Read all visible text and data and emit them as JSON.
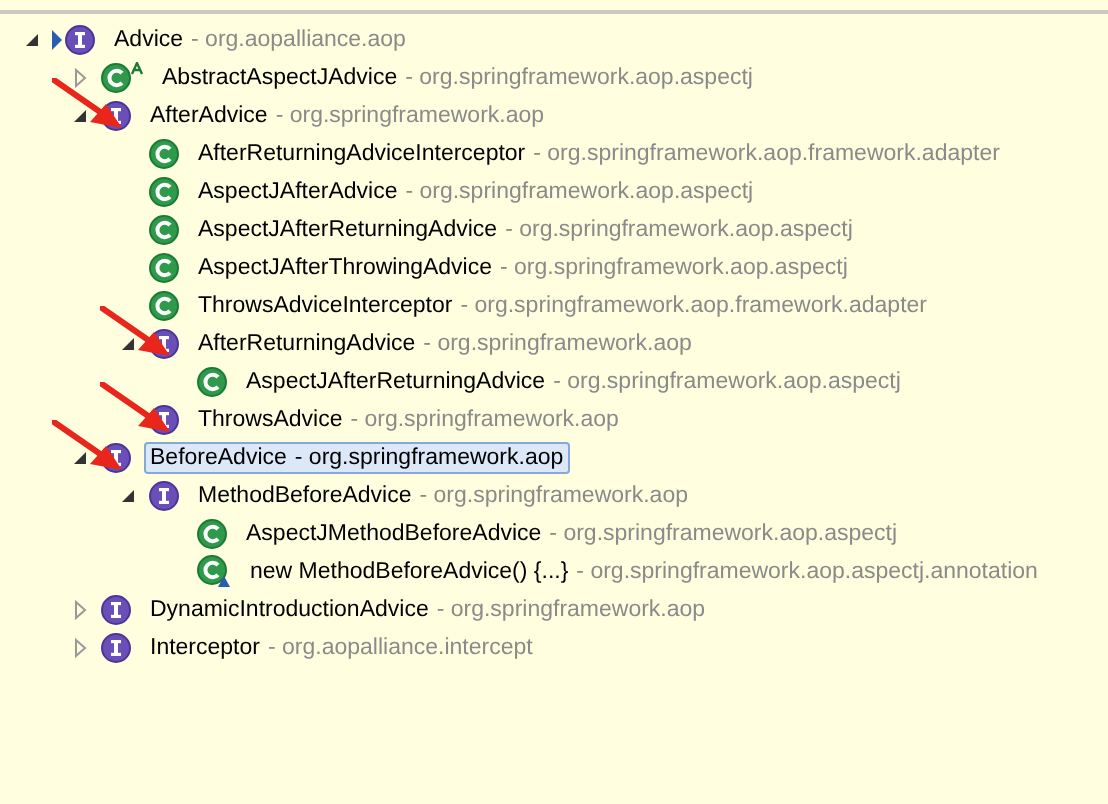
{
  "tree": [
    {
      "name": "Advice",
      "package": "- org.aopalliance.aop",
      "kind": "focus_interface",
      "expanded": true,
      "selected": false,
      "marked": false,
      "children": [
        {
          "name": "AbstractAspectJAdvice",
          "package": "- org.springframework.aop.aspectj",
          "kind": "abstract_class",
          "expanded": false,
          "selected": false,
          "marked": false
        },
        {
          "name": "AfterAdvice",
          "package": "- org.springframework.aop",
          "kind": "interface",
          "expanded": true,
          "selected": false,
          "marked": true,
          "children": [
            {
              "name": "AfterReturningAdviceInterceptor",
              "package": "- org.springframework.aop.framework.adapter",
              "kind": "class",
              "selected": false,
              "marked": false
            },
            {
              "name": "AspectJAfterAdvice",
              "package": "- org.springframework.aop.aspectj",
              "kind": "class",
              "selected": false,
              "marked": false
            },
            {
              "name": "AspectJAfterReturningAdvice",
              "package": "- org.springframework.aop.aspectj",
              "kind": "class",
              "selected": false,
              "marked": false
            },
            {
              "name": "AspectJAfterThrowingAdvice",
              "package": "- org.springframework.aop.aspectj",
              "kind": "class",
              "selected": false,
              "marked": false
            },
            {
              "name": "ThrowsAdviceInterceptor",
              "package": "- org.springframework.aop.framework.adapter",
              "kind": "class",
              "selected": false,
              "marked": false
            },
            {
              "name": "AfterReturningAdvice",
              "package": "- org.springframework.aop",
              "kind": "interface",
              "expanded": true,
              "selected": false,
              "marked": true,
              "children": [
                {
                  "name": "AspectJAfterReturningAdvice",
                  "package": "- org.springframework.aop.aspectj",
                  "kind": "class",
                  "selected": false,
                  "marked": false
                }
              ]
            },
            {
              "name": "ThrowsAdvice",
              "package": "- org.springframework.aop",
              "kind": "interface",
              "selected": false,
              "marked": true
            }
          ]
        },
        {
          "name": "BeforeAdvice",
          "package": "- org.springframework.aop",
          "kind": "interface",
          "expanded": true,
          "selected": true,
          "marked": true,
          "children": [
            {
              "name": "MethodBeforeAdvice",
              "package": "- org.springframework.aop",
              "kind": "interface",
              "expanded": true,
              "selected": false,
              "marked": false,
              "children": [
                {
                  "name": "AspectJMethodBeforeAdvice",
                  "package": "- org.springframework.aop.aspectj",
                  "kind": "class",
                  "selected": false,
                  "marked": false
                },
                {
                  "name": "new MethodBeforeAdvice() {...}",
                  "package": "- org.springframework.aop.aspectj.annotation",
                  "kind": "anonymous_class",
                  "selected": false,
                  "marked": false
                }
              ]
            }
          ]
        },
        {
          "name": "DynamicIntroductionAdvice",
          "package": "- org.springframework.aop",
          "kind": "interface",
          "expanded": false,
          "selected": false,
          "marked": false
        },
        {
          "name": "Interceptor",
          "package": "- org.aopalliance.intercept",
          "kind": "interface",
          "expanded": false,
          "selected": false,
          "marked": false
        }
      ]
    }
  ]
}
